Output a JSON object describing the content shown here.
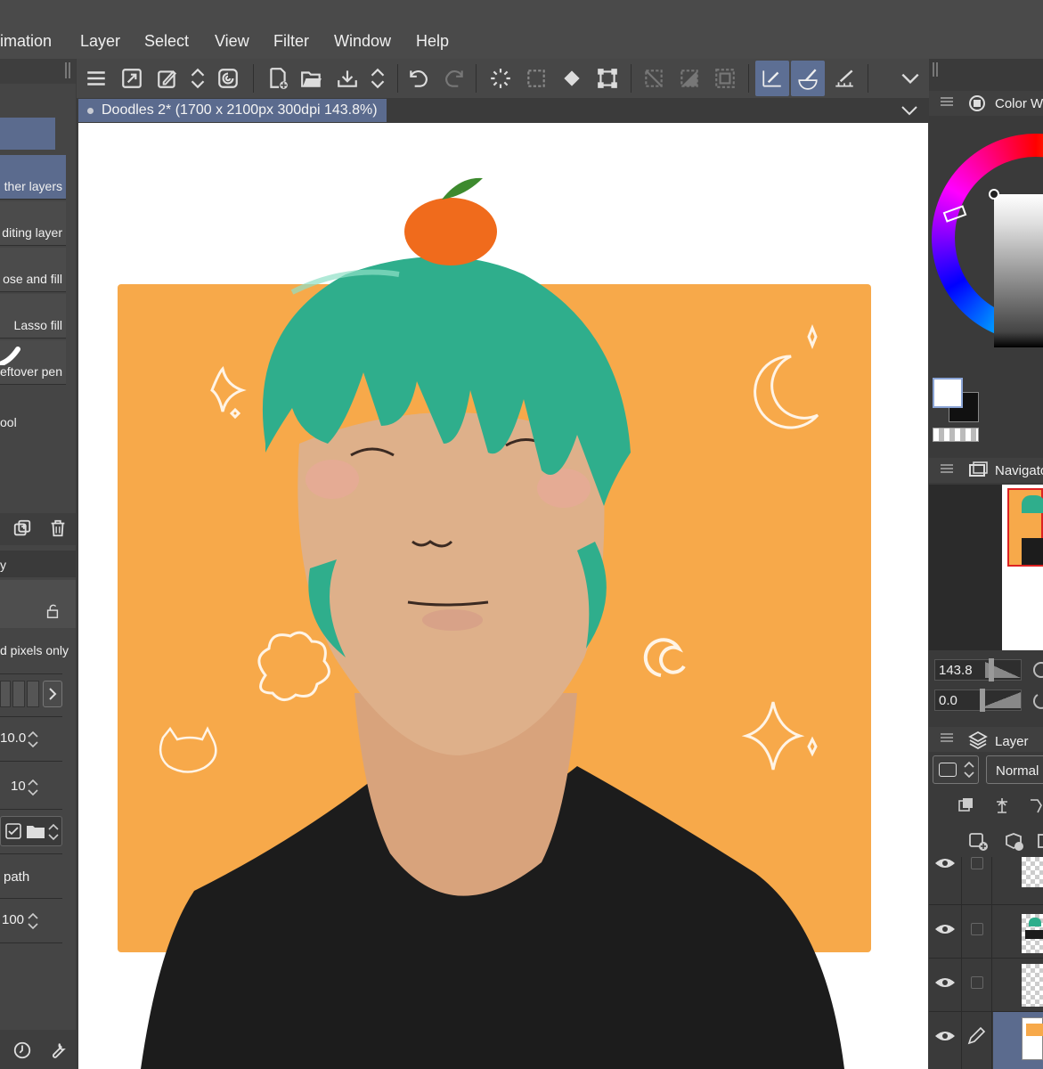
{
  "menu": {
    "items": [
      "imation",
      "Layer",
      "Select",
      "View",
      "Filter",
      "Window",
      "Help"
    ]
  },
  "document_tab": {
    "label": "Doodles 2* (1700 x 2100px 300dpi 143.8%)"
  },
  "sub_tools": [
    {
      "label": "ther layers",
      "selected": true
    },
    {
      "label": "diting layer",
      "selected": false
    },
    {
      "label": "ose and fill",
      "selected": false
    },
    {
      "label": "Lasso fill",
      "selected": false
    },
    {
      "label": "eftover pen",
      "selected": false
    }
  ],
  "left_panel": {
    "tool_label": "ool",
    "property_tab_label": "y",
    "pixels_label": "d pixels only",
    "value_1": "10.0",
    "value_2": "10",
    "path_label": "path",
    "value_3": "100"
  },
  "color_panel": {
    "title": "Color W"
  },
  "navigator": {
    "title": "Navigato",
    "zoom": "143.8",
    "rotation": "0.0"
  },
  "layer_panel": {
    "title": "Layer",
    "blend_mode": "Normal"
  },
  "colors": {
    "accent": "#5b6b8e",
    "artwork_background": "#f7a94a",
    "hair": "#2fae8c",
    "orange": "#f06b1c",
    "skin": "#deb08a",
    "shirt": "#1c1c1c"
  }
}
